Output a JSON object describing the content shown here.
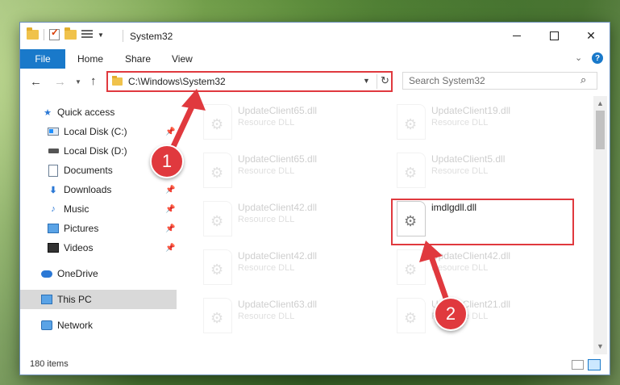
{
  "window": {
    "title": "System32",
    "controls": {
      "minimize": "—",
      "maximize": "☐",
      "close": "✕"
    }
  },
  "ribbon": {
    "tabs": [
      {
        "label": "File"
      },
      {
        "label": "Home"
      },
      {
        "label": "Share"
      },
      {
        "label": "View"
      }
    ],
    "help": "?"
  },
  "address_bar": {
    "path": "C:\\Windows\\System32"
  },
  "search": {
    "placeholder": "Search System32"
  },
  "sidebar": {
    "items": [
      {
        "label": "Quick access",
        "icon": "star-icon"
      },
      {
        "label": "Local Disk (C:)",
        "icon": "drive-c-icon",
        "pinned": true
      },
      {
        "label": "Local Disk (D:)",
        "icon": "drive-icon"
      },
      {
        "label": "Documents",
        "icon": "documents-icon"
      },
      {
        "label": "Downloads",
        "icon": "downloads-icon",
        "pinned": true
      },
      {
        "label": "Music",
        "icon": "music-icon",
        "pinned": true
      },
      {
        "label": "Pictures",
        "icon": "pictures-icon",
        "pinned": true
      },
      {
        "label": "Videos",
        "icon": "videos-icon",
        "pinned": true
      },
      {
        "label": "OneDrive",
        "icon": "onedrive-icon"
      },
      {
        "label": "This PC",
        "icon": "this-pc-icon",
        "selected": true
      },
      {
        "label": "Network",
        "icon": "network-icon"
      }
    ]
  },
  "files": [
    {
      "name": "UpdateClient65.dll",
      "type": "Resource DLL",
      "faded": true
    },
    {
      "name": "UpdateClient19.dll",
      "type": "Resource DLL",
      "faded": true
    },
    {
      "name": "UpdateClient65.dll",
      "type": "Resource DLL",
      "faded": true
    },
    {
      "name": "UpdateClient5.dll",
      "type": "Resource DLL",
      "faded": true
    },
    {
      "name": "UpdateClient42.dll",
      "type": "Resource DLL",
      "faded": true
    },
    {
      "name": "imdlgdll.dll",
      "type": "",
      "faded": false
    },
    {
      "name": "UpdateClient42.dll",
      "type": "Resource DLL",
      "faded": true
    },
    {
      "name": "UpdateClient42.dll",
      "type": "Resource DLL",
      "faded": true
    },
    {
      "name": "UpdateClient63.dll",
      "type": "Resource DLL",
      "faded": true
    },
    {
      "name": "UpdateClient21.dll",
      "type": "Resource DLL",
      "faded": true
    }
  ],
  "status": {
    "item_count": "180 items"
  },
  "annotations": [
    {
      "number": "1"
    },
    {
      "number": "2"
    }
  ],
  "colors": {
    "accent": "#1979ca",
    "annotation_red": "#e0393e",
    "selection": "#cce8ff"
  }
}
